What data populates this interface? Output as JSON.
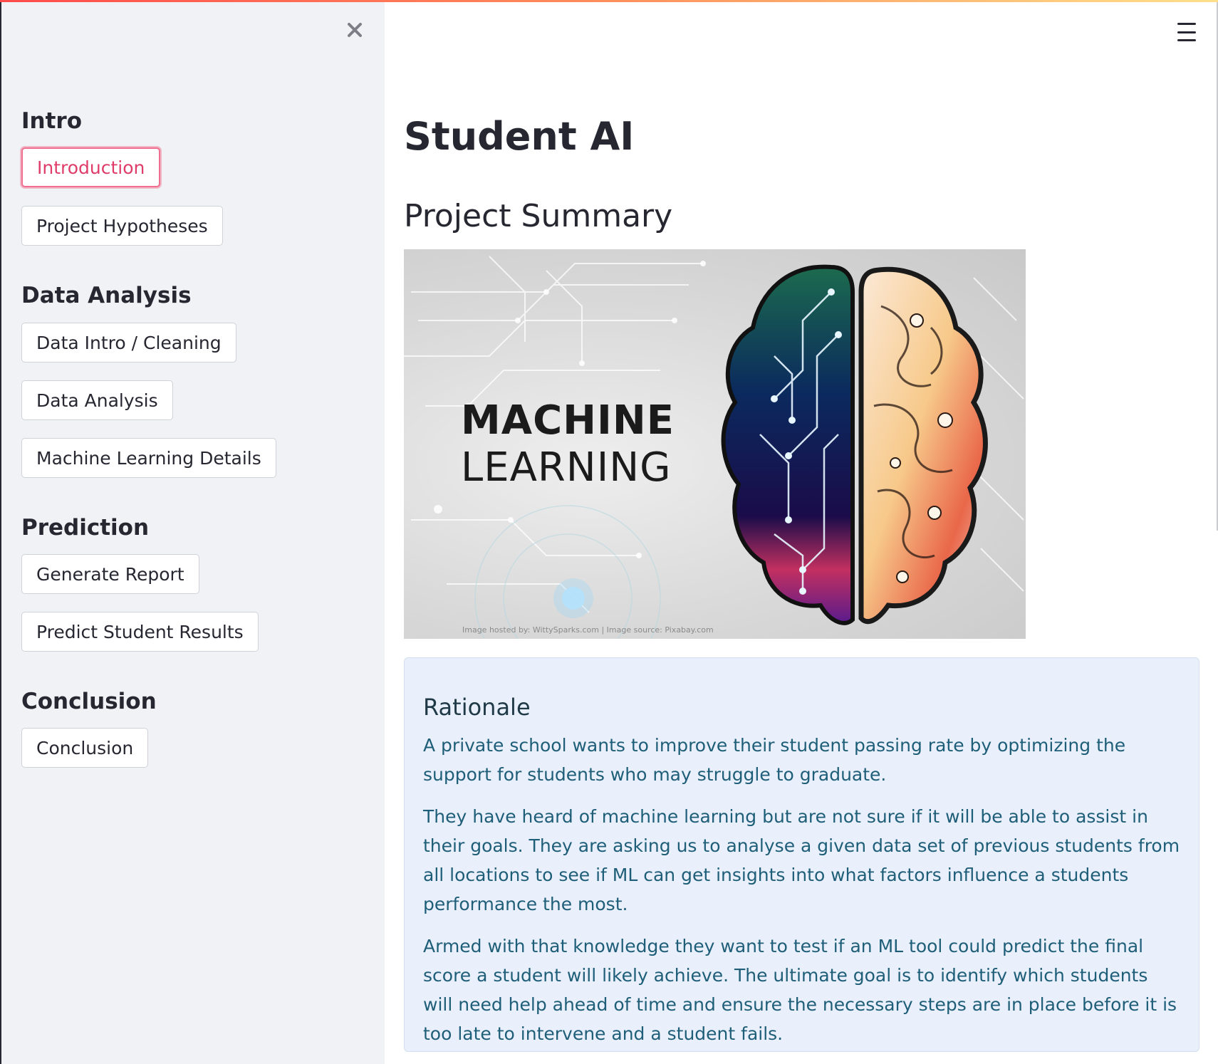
{
  "sidebar": {
    "sections": [
      {
        "heading": "Intro",
        "buttons": [
          "Introduction",
          "Project Hypotheses"
        ]
      },
      {
        "heading": "Data Analysis",
        "buttons": [
          "Data Intro / Cleaning",
          "Data Analysis",
          "Machine Learning Details"
        ]
      },
      {
        "heading": "Prediction",
        "buttons": [
          "Generate Report",
          "Predict Student Results"
        ]
      },
      {
        "heading": "Conclusion",
        "buttons": [
          "Conclusion"
        ]
      }
    ],
    "active_button": "Introduction",
    "close_icon": "close-icon"
  },
  "header": {
    "menu_icon": "hamburger-menu-icon"
  },
  "main": {
    "title": "Student AI",
    "subheading": "Project Summary",
    "hero_image": {
      "text_line1": "MACHINE",
      "text_line2": "LEARNING",
      "credit": "Image hosted by: WittySparks.com | Image source: Pixabay.com"
    },
    "rationale": {
      "title": "Rationale",
      "paragraphs": [
        "A private school wants to improve their student passing rate by optimizing the support for students who may struggle to graduate.",
        "They have heard of machine learning but are not sure if it will be able to assist in their goals. They are asking us to analyse a given data set of previous students from all locations to see if ML can get insights into what factors influence a students performance the most.",
        "Armed with that knowledge they want to test if an ML tool could predict the final score a student will likely achieve. The ultimate goal is to identify which students will need help ahead of time and ensure the necessary steps are in place before it is too late to intervene and a student fails."
      ]
    }
  },
  "colors": {
    "sidebar_bg": "#f0f2f6",
    "active_accent": "#e03c6a",
    "info_bg": "#e9f0fb",
    "info_text": "#1f5e78"
  }
}
